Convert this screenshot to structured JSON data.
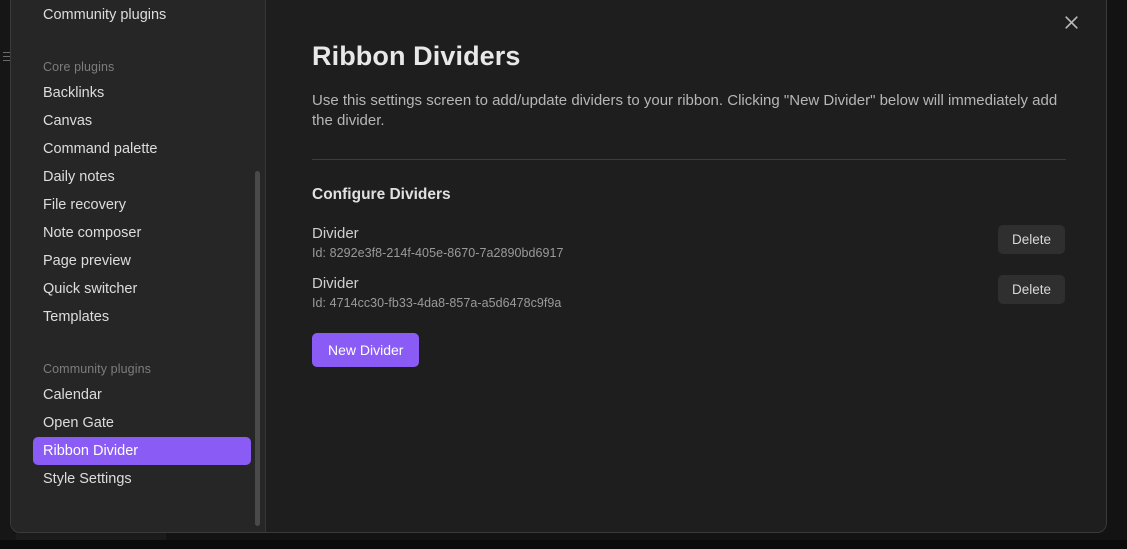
{
  "window": {
    "background_color": "#0d0d0d",
    "accent_color": "#8a5cf5"
  },
  "modal": {
    "close_label": "close-icon"
  },
  "sidebar": {
    "top_item": {
      "label": "Community plugins"
    },
    "core_heading": {
      "label": "Core plugins"
    },
    "core_items": [
      {
        "label": "Backlinks"
      },
      {
        "label": "Canvas"
      },
      {
        "label": "Command palette"
      },
      {
        "label": "Daily notes"
      },
      {
        "label": "File recovery"
      },
      {
        "label": "Note composer"
      },
      {
        "label": "Page preview"
      },
      {
        "label": "Quick switcher"
      },
      {
        "label": "Templates"
      }
    ],
    "community_heading": {
      "label": "Community plugins"
    },
    "community_items": [
      {
        "label": "Calendar",
        "active": false
      },
      {
        "label": "Open Gate",
        "active": false
      },
      {
        "label": "Ribbon Divider",
        "active": true
      },
      {
        "label": "Style Settings",
        "active": false
      }
    ]
  },
  "main": {
    "title": "Ribbon Dividers",
    "description": "Use this settings screen to add/update dividers to your ribbon. Clicking \"New Divider\" below will immediately add the divider.",
    "section_title": "Configure Dividers",
    "dividers": [
      {
        "name": "Divider",
        "id": "Id: 8292e3f8-214f-405e-8670-7a2890bd6917",
        "delete_label": "Delete"
      },
      {
        "name": "Divider",
        "id": "Id: 4714cc30-fb33-4da8-857a-a5d6478c9f9a",
        "delete_label": "Delete"
      }
    ],
    "new_divider_label": "New Divider"
  }
}
